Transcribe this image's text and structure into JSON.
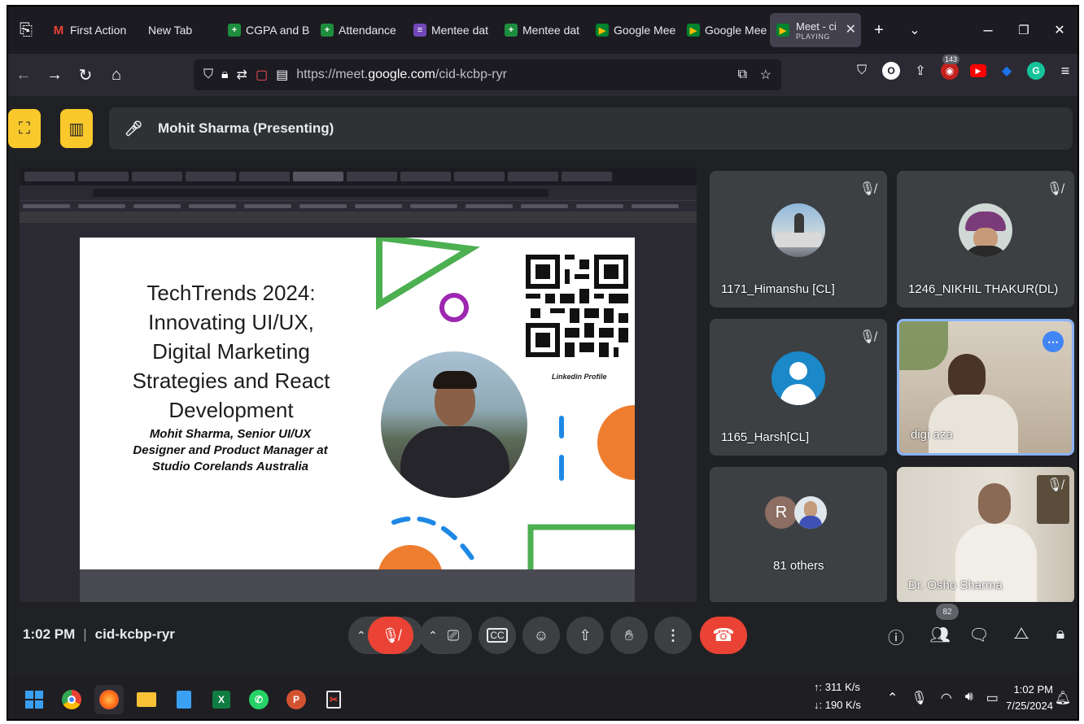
{
  "browser": {
    "tabs": [
      {
        "label": "First Action",
        "icon": "gmail-icon",
        "color": "#ea4335",
        "glyph": "M"
      },
      {
        "label": "New Tab",
        "icon": "",
        "color": "",
        "glyph": ""
      },
      {
        "label": "CGPA and B",
        "icon": "sheets-icon",
        "color": "#1e8e3e",
        "glyph": "+"
      },
      {
        "label": "Attendance",
        "icon": "sheets-icon",
        "color": "#1e8e3e",
        "glyph": "+"
      },
      {
        "label": "Mentee dat",
        "icon": "forms-icon",
        "color": "#7248b9",
        "glyph": "≡"
      },
      {
        "label": "Mentee dat",
        "icon": "sheets-icon",
        "color": "#1e8e3e",
        "glyph": "+"
      },
      {
        "label": "Google Mee",
        "icon": "meet-icon",
        "color": "#fbbc04",
        "glyph": "▶"
      },
      {
        "label": "Google Mee",
        "icon": "meet-icon",
        "color": "#fbbc04",
        "glyph": "▶"
      }
    ],
    "active_tab": {
      "label": "Meet - ci",
      "status": "PLAYING"
    },
    "url": {
      "prefix": "https://meet.",
      "domain": "google.com",
      "path": "/cid-kcbp-ryr"
    },
    "extension_badge": "143"
  },
  "meet": {
    "presenter_label": "Mohit Sharma (Presenting)",
    "slide": {
      "title_lines": [
        "TechTrends 2024:",
        "Innovating UI/UX,",
        "Digital Marketing",
        "Strategies and React",
        "Development"
      ],
      "subtitle_lines": [
        "Mohit Sharma, Senior UI/UX",
        "Designer and Product Manager at",
        "Studio Corelands Australia"
      ],
      "qr_caption": "Linkedin Profile"
    },
    "participants": [
      {
        "name": "1171_Himanshu [CL]",
        "muted": true
      },
      {
        "name": "1246_NIKHIL THAKUR(DL)",
        "muted": true
      },
      {
        "name": "1165_Harsh[CL]",
        "muted": true
      },
      {
        "name": "digi aza",
        "muted": false
      },
      {
        "name": "81 others",
        "avatar_letter": "R",
        "muted": false
      },
      {
        "name": "Dr. Osho Sharma",
        "muted": true
      }
    ],
    "controls": {
      "time": "1:02 PM",
      "meeting_code": "cid-kcbp-ryr",
      "participant_count": "82"
    }
  },
  "taskbar": {
    "upload_speed": "311 K/s",
    "download_speed": "190 K/s",
    "clock_time": "1:02 PM",
    "clock_date": "7/25/2024"
  }
}
